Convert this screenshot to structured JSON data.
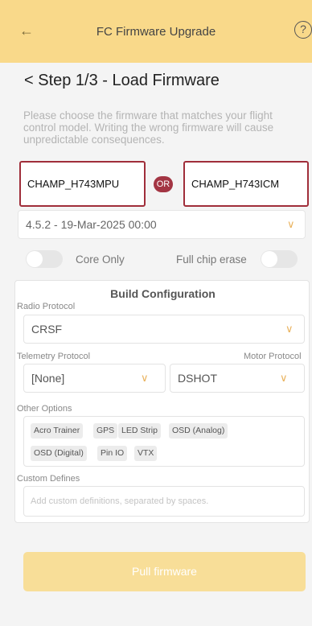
{
  "header": {
    "back_icon": "←",
    "title": "FC Firmware Upgrade",
    "help_icon": "?"
  },
  "step": {
    "title": "< Step 1/3 - Load Firmware"
  },
  "description": "Please choose the firmware that matches your flight control model. Writing the wrong firmware will cause unpredictable consequences.",
  "firmware": {
    "left": "CHAMP_H743MPU",
    "or": "OR",
    "right": "CHAMP_H743ICM"
  },
  "version": {
    "value": "4.5.2 - 19-Mar-2025 00:00"
  },
  "toggles": {
    "core_only": {
      "label": "Core Only",
      "on": false
    },
    "full_chip_erase": {
      "label": "Full chip erase",
      "on": false
    }
  },
  "build_config": {
    "title": "Build Configuration",
    "radio_protocol": {
      "label": "Radio Protocol",
      "value": "CRSF"
    },
    "telemetry_protocol": {
      "label": "Telemetry Protocol",
      "value": "[None]"
    },
    "motor_protocol": {
      "label": "Motor Protocol",
      "value": "DSHOT"
    },
    "other_options": {
      "label": "Other Options",
      "chips": [
        "Acro Trainer",
        "GPS",
        "LED Strip",
        "OSD (Analog)",
        "OSD (Digital)",
        "Pin IO",
        "VTX"
      ]
    },
    "custom_defines": {
      "label": "Custom Defines",
      "placeholder": "Add custom definitions, separated by spaces."
    }
  },
  "pull_button": {
    "label": "Pull firmware"
  },
  "colors": {
    "header_bg": "#f9d98a",
    "accent": "#e9b25d",
    "highlight_border": "#a02e3a",
    "or_badge": "#a33543",
    "button_bg": "#f8de98"
  }
}
